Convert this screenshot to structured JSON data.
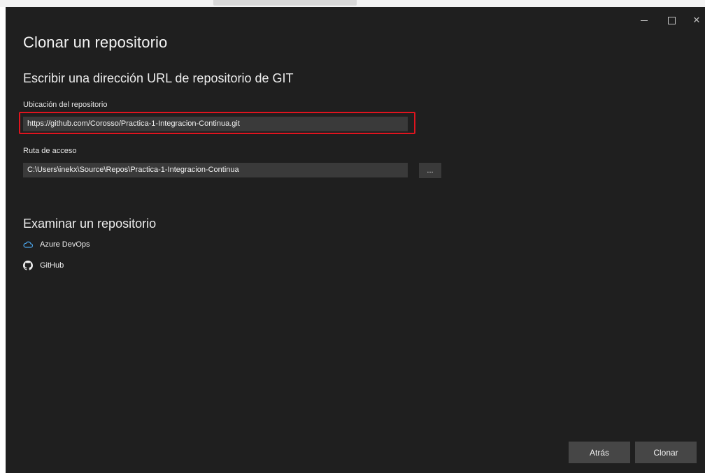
{
  "dialog": {
    "title": "Clonar un repositorio",
    "subtitle": "Escribir una dirección URL de repositorio de GIT"
  },
  "window_controls": {
    "minimize_icon": "minimize-icon",
    "maximize_icon": "maximize-icon",
    "close_symbol": "✕"
  },
  "repo_location": {
    "label": "Ubicación del repositorio",
    "value": "https://github.com/Corosso/Practica-1-Integracion-Continua.git"
  },
  "path": {
    "label": "Ruta de acceso",
    "value": "C:\\Users\\inekx\\Source\\Repos\\Practica-1-Integracion-Continua",
    "browse_label": "..."
  },
  "browse_section": {
    "title": "Examinar un repositorio",
    "items": [
      {
        "label": "Azure DevOps",
        "icon": "cloud-icon"
      },
      {
        "label": "GitHub",
        "icon": "github-icon"
      }
    ]
  },
  "footer": {
    "back_label": "Atrás",
    "clone_label": "Clonar"
  },
  "colors": {
    "background": "#1f1f1f",
    "input_background": "#3a3a3a",
    "highlight": "#e0141e",
    "button_background": "#464646",
    "azure_icon": "#4aa3e8"
  }
}
